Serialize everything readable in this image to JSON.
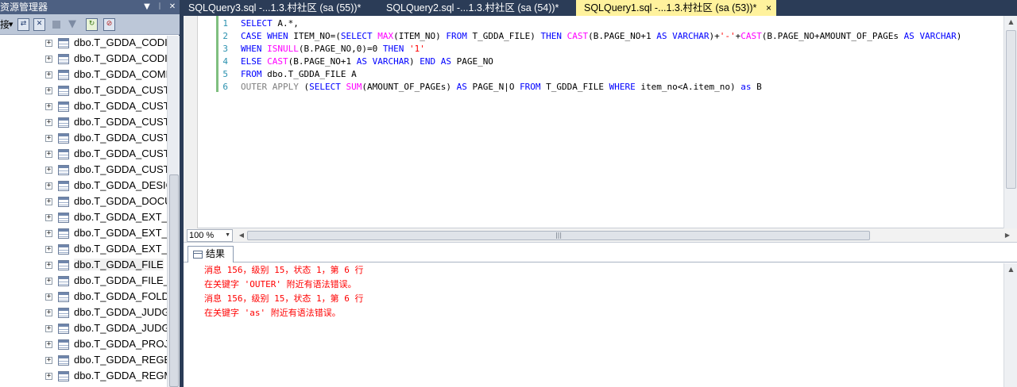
{
  "explorer": {
    "title": "资源管理器",
    "pin": "▾ ♯ ×",
    "toolbar_label": "接",
    "items": [
      "dbo.T_GDDA_CODIN",
      "dbo.T_GDDA_CODIN",
      "dbo.T_GDDA_COMP",
      "dbo.T_GDDA_CUSTC",
      "dbo.T_GDDA_CUSTC",
      "dbo.T_GDDA_CUSTC",
      "dbo.T_GDDA_CUSTC",
      "dbo.T_GDDA_CUSTC",
      "dbo.T_GDDA_CUSTC",
      "dbo.T_GDDA_DESIG",
      "dbo.T_GDDA_DOCU",
      "dbo.T_GDDA_EXT_H",
      "dbo.T_GDDA_EXT_H",
      "dbo.T_GDDA_EXT_PI",
      "dbo.T_GDDA_FILE",
      "dbo.T_GDDA_FILE_C",
      "dbo.T_GDDA_FOLDE",
      "dbo.T_GDDA_JUDGE",
      "dbo.T_GDDA_JUDGE",
      "dbo.T_GDDA_PROJE",
      "dbo.T_GDDA_REGBO",
      "dbo.T_GDDA_REGM"
    ],
    "selected_index": 14
  },
  "tabs": [
    {
      "label": "SQLQuery3.sql -...1.3.村社区 (sa (55))*"
    },
    {
      "label": "SQLQuery2.sql -...1.3.村社区 (sa (54))*"
    },
    {
      "label": "SQLQuery1.sql -...1.3.村社区 (sa (53))*"
    }
  ],
  "active_tab_close": "×",
  "editor": {
    "line_numbers": [
      "1",
      "2",
      "3",
      "4",
      "5",
      "6"
    ],
    "lines": [
      [
        {
          "t": "SELECT",
          "c": "k"
        },
        {
          "t": " A.*,",
          "c": ""
        }
      ],
      [
        {
          "t": "CASE WHEN",
          "c": "k"
        },
        {
          "t": " ITEM_NO=(",
          "c": ""
        },
        {
          "t": "SELECT",
          "c": "k"
        },
        {
          "t": " ",
          "c": ""
        },
        {
          "t": "MAX",
          "c": "f"
        },
        {
          "t": "(ITEM_NO) ",
          "c": ""
        },
        {
          "t": "FROM",
          "c": "k"
        },
        {
          "t": " T_GDDA_FILE) ",
          "c": ""
        },
        {
          "t": "THEN",
          "c": "k"
        },
        {
          "t": " ",
          "c": ""
        },
        {
          "t": "CAST",
          "c": "f"
        },
        {
          "t": "(B.PAGE_NO+1 ",
          "c": ""
        },
        {
          "t": "AS",
          "c": "k"
        },
        {
          "t": " ",
          "c": ""
        },
        {
          "t": "VARCHAR",
          "c": "k"
        },
        {
          "t": ")+",
          "c": ""
        },
        {
          "t": "'-'",
          "c": "s"
        },
        {
          "t": "+",
          "c": ""
        },
        {
          "t": "CAST",
          "c": "f"
        },
        {
          "t": "(B.PAGE_NO+AMOUNT_OF_PAGEs ",
          "c": ""
        },
        {
          "t": "AS",
          "c": "k"
        },
        {
          "t": " ",
          "c": ""
        },
        {
          "t": "VARCHAR",
          "c": "k"
        },
        {
          "t": ")",
          "c": ""
        }
      ],
      [
        {
          "t": "WHEN",
          "c": "k"
        },
        {
          "t": " ",
          "c": ""
        },
        {
          "t": "ISNULL",
          "c": "f"
        },
        {
          "t": "(B.PAGE_NO,0)=0 ",
          "c": ""
        },
        {
          "t": "THEN",
          "c": "k"
        },
        {
          "t": " ",
          "c": ""
        },
        {
          "t": "'1'",
          "c": "s"
        }
      ],
      [
        {
          "t": "ELSE",
          "c": "k"
        },
        {
          "t": " ",
          "c": ""
        },
        {
          "t": "CAST",
          "c": "f"
        },
        {
          "t": "(B.PAGE_NO+1 ",
          "c": ""
        },
        {
          "t": "AS",
          "c": "k"
        },
        {
          "t": " ",
          "c": ""
        },
        {
          "t": "VARCHAR",
          "c": "k"
        },
        {
          "t": ") ",
          "c": ""
        },
        {
          "t": "END",
          "c": "k"
        },
        {
          "t": " ",
          "c": ""
        },
        {
          "t": "AS",
          "c": "k"
        },
        {
          "t": " PAGE_NO",
          "c": ""
        }
      ],
      [
        {
          "t": "FROM",
          "c": "k"
        },
        {
          "t": " dbo.T_GDDA_FILE A",
          "c": ""
        }
      ],
      [
        {
          "t": "OUTER APPLY ",
          "c": "g"
        },
        {
          "t": "(",
          "c": ""
        },
        {
          "t": "SELECT",
          "c": "k"
        },
        {
          "t": " ",
          "c": ""
        },
        {
          "t": "SUM",
          "c": "f"
        },
        {
          "t": "(AMOUNT_OF_PAGEs) ",
          "c": ""
        },
        {
          "t": "AS",
          "c": "k"
        },
        {
          "t": " PAGE_N",
          "c": ""
        },
        {
          "t": "|",
          "c": "caret"
        },
        {
          "t": "O ",
          "c": ""
        },
        {
          "t": "FROM",
          "c": "k"
        },
        {
          "t": " T_GDDA_FILE ",
          "c": ""
        },
        {
          "t": "WHERE",
          "c": "k"
        },
        {
          "t": " item_no<A.item_no) ",
          "c": ""
        },
        {
          "t": "as",
          "c": "k"
        },
        {
          "t": " B",
          "c": ""
        }
      ]
    ]
  },
  "zoom": "100 %",
  "results_tab_label": "结果",
  "messages": [
    "消息 156，级别 15，状态 1，第 6 行",
    "在关键字 'OUTER' 附近有语法错误。",
    "消息 156，级别 15，状态 1，第 6 行",
    "在关键字 'as' 附近有语法错误。"
  ]
}
